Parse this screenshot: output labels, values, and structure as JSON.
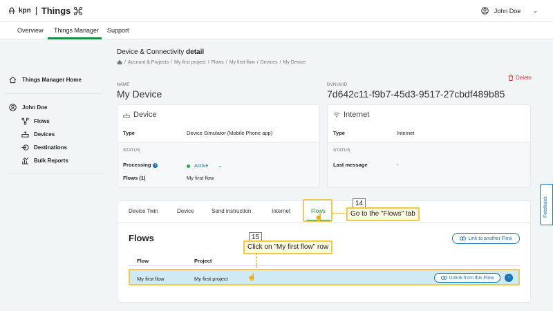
{
  "header": {
    "brand": "kpn",
    "app_name": "Things",
    "user_name": "John Doe"
  },
  "nav": {
    "items": [
      "Overview",
      "Things Manager",
      "Support"
    ],
    "active": "Things Manager"
  },
  "sidebar": {
    "home": "Things Manager Home",
    "user": "John Doe",
    "items": [
      {
        "label": "Flows",
        "icon": "flows-icon"
      },
      {
        "label": "Devices",
        "icon": "devices-icon"
      },
      {
        "label": "Destinations",
        "icon": "destinations-icon"
      },
      {
        "label": "Bulk Reports",
        "icon": "bulk-reports-icon"
      }
    ]
  },
  "page": {
    "title_prefix": "Device & Connectivity",
    "title_bold": "detail",
    "breadcrumb": [
      "Account & Projects",
      "My first project",
      "Flows",
      "My first flow",
      "Devices",
      "My Device"
    ],
    "delete_label": "Delete",
    "name_label": "NAME",
    "name_value": "My Device",
    "dvnuuid_label": "DVNUUID",
    "dvnuuid_value": "7d642c11-f9b7-45d3-9517-27cbdf489b85"
  },
  "device_card": {
    "title": "Device",
    "type_label": "Type",
    "type_value": "Device Simulator (Mobile Phone app)",
    "status_label": "STATUS",
    "processing_label": "Processing",
    "processing_value": "Active",
    "flows_label": "Flows (1)",
    "flows_value": "My first flow"
  },
  "internet_card": {
    "title": "Internet",
    "type_label": "Type",
    "type_value": "Internet",
    "status_label": "STATUS",
    "last_message_label": "Last message",
    "last_message_value": "-"
  },
  "tabs": {
    "items": [
      "Device Twin",
      "Device",
      "Send instruction",
      "Internet",
      "Flows"
    ],
    "active": "Flows"
  },
  "flows_panel": {
    "heading": "Flows",
    "link_button": "Link to another Flow",
    "columns": [
      "Flow",
      "Project"
    ],
    "rows": [
      {
        "flow": "My first flow",
        "project": "My first project",
        "action": "Unlink from this Flow"
      }
    ]
  },
  "annotations": {
    "step14": {
      "number": "14",
      "text": "Go to the \"Flows\" tab"
    },
    "step15": {
      "number": "15",
      "text": "Click on \"My first flow\" row"
    }
  },
  "feedback_label": "Feedback",
  "colors": {
    "accent_green": "#1e8a3c",
    "link_blue": "#1a73b8",
    "highlight_yellow": "#f2c94c",
    "delete_red": "#d73a3a"
  }
}
